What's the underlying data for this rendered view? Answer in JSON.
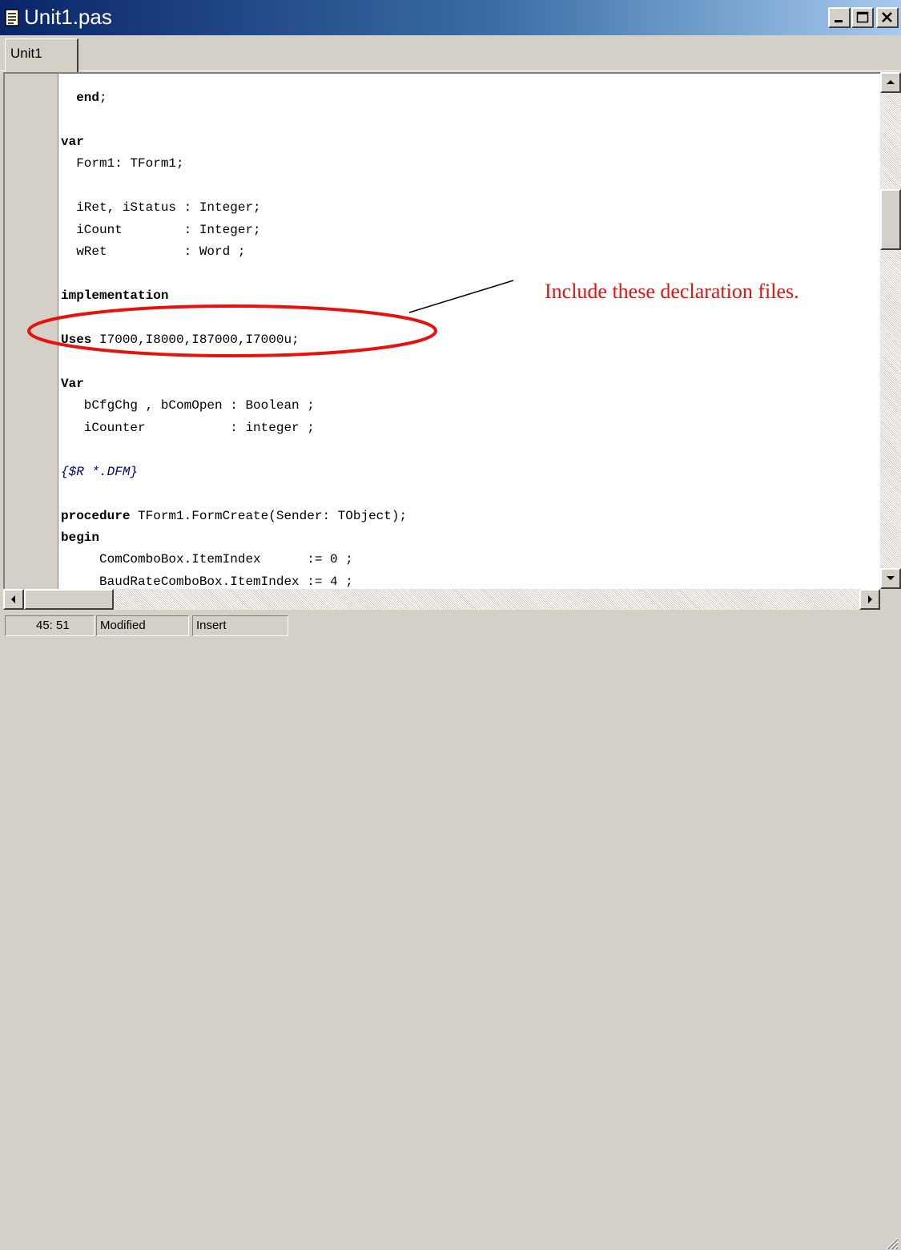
{
  "window": {
    "title": "Unit1.pas",
    "title_icon": "document-icon",
    "buttons": [
      "minimize-icon",
      "maximize-icon",
      "close-icon"
    ]
  },
  "tabs": [
    {
      "label": "Unit1",
      "active": true
    }
  ],
  "code": {
    "lines": [
      {
        "parts": [
          {
            "t": "  "
          },
          {
            "t": "end",
            "k": "kw"
          },
          {
            "t": ";"
          }
        ]
      },
      {
        "parts": []
      },
      {
        "parts": [
          {
            "t": "var",
            "k": "kw"
          }
        ]
      },
      {
        "parts": [
          {
            "t": "  Form1: TForm1;"
          }
        ]
      },
      {
        "parts": []
      },
      {
        "parts": [
          {
            "t": "  iRet, iStatus : Integer;"
          }
        ]
      },
      {
        "parts": [
          {
            "t": "  iCount        : Integer;"
          }
        ]
      },
      {
        "parts": [
          {
            "t": "  wRet          : Word ;"
          }
        ]
      },
      {
        "parts": []
      },
      {
        "parts": [
          {
            "t": "implementation",
            "k": "kw"
          }
        ]
      },
      {
        "parts": []
      },
      {
        "parts": [
          {
            "t": "Uses",
            "k": "kw"
          },
          {
            "t": " I7000,I8000,I87000,I7000u;"
          }
        ]
      },
      {
        "parts": []
      },
      {
        "parts": [
          {
            "t": "Var",
            "k": "kw"
          }
        ]
      },
      {
        "parts": [
          {
            "t": "   bCfgChg , bComOpen : Boolean ;"
          }
        ]
      },
      {
        "parts": [
          {
            "t": "   iCounter           : integer ;"
          }
        ]
      },
      {
        "parts": []
      },
      {
        "parts": [
          {
            "t": "{$R *.DFM}",
            "k": "cm"
          }
        ]
      },
      {
        "parts": []
      },
      {
        "parts": [
          {
            "t": "procedure",
            "k": "kw"
          },
          {
            "t": " TForm1.FormCreate(Sender: TObject);"
          }
        ]
      },
      {
        "parts": [
          {
            "t": "begin",
            "k": "kw"
          }
        ]
      },
      {
        "parts": [
          {
            "t": "     ComComboBox.ItemIndex      := 0 ;"
          }
        ]
      },
      {
        "parts": [
          {
            "t": "     BaudRateComboBox.ItemIndex := 4 ;"
          }
        ]
      }
    ]
  },
  "scrollbars": {
    "vertical": {
      "up": "scroll-up-arrow-icon",
      "down": "scroll-down-arrow-icon"
    },
    "horizontal": {
      "left": "scroll-left-arrow-icon",
      "right": "scroll-right-arrow-icon"
    }
  },
  "status": {
    "position": "45: 51",
    "modified": "Modified",
    "mode": "Insert"
  },
  "annotation": {
    "text": "Include these declaration files.",
    "color": "#e8120d"
  },
  "colors": {
    "titlebar_start": "#0a246a",
    "titlebar_end": "#a6caf0",
    "keyword": "#000000",
    "comment": "#000080",
    "annotation_red": "#e8120d"
  }
}
